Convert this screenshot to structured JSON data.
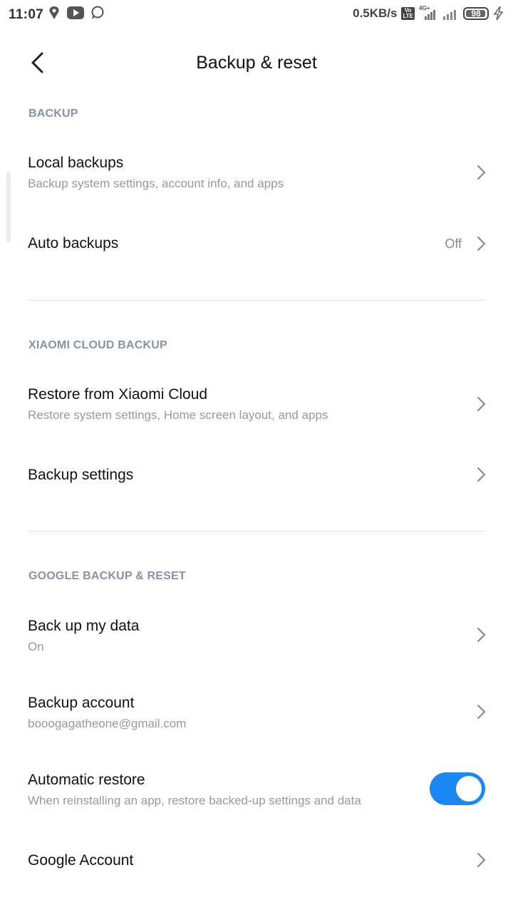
{
  "status": {
    "time": "11:07",
    "net_speed": "0.5KB/s",
    "volte_top": "Vo",
    "volte_bottom": "LTE",
    "network_type": "4G+",
    "battery": "98"
  },
  "header": {
    "title": "Backup & reset"
  },
  "sections": {
    "backup": {
      "header": "BACKUP",
      "local_backups": {
        "title": "Local backups",
        "subtitle": "Backup system settings, account info, and apps"
      },
      "auto_backups": {
        "title": "Auto backups",
        "value": "Off"
      }
    },
    "cloud": {
      "header": "XIAOMI CLOUD BACKUP",
      "restore": {
        "title": "Restore from Xiaomi Cloud",
        "subtitle": "Restore system settings, Home screen layout, and apps"
      },
      "settings": {
        "title": "Backup settings"
      }
    },
    "google": {
      "header": "GOOGLE BACKUP & RESET",
      "back_up_data": {
        "title": "Back up my data",
        "subtitle": "On"
      },
      "backup_account": {
        "title": "Backup account",
        "subtitle": "booogagatheone@gmail.com"
      },
      "auto_restore": {
        "title": "Automatic restore",
        "subtitle": "When reinstalling an app, restore backed-up settings and data",
        "enabled": true
      },
      "google_account": {
        "title": "Google Account"
      }
    }
  },
  "colors": {
    "accent": "#1a87f5",
    "section_header": "#8891a8",
    "subtitle": "#9a9a9a"
  }
}
